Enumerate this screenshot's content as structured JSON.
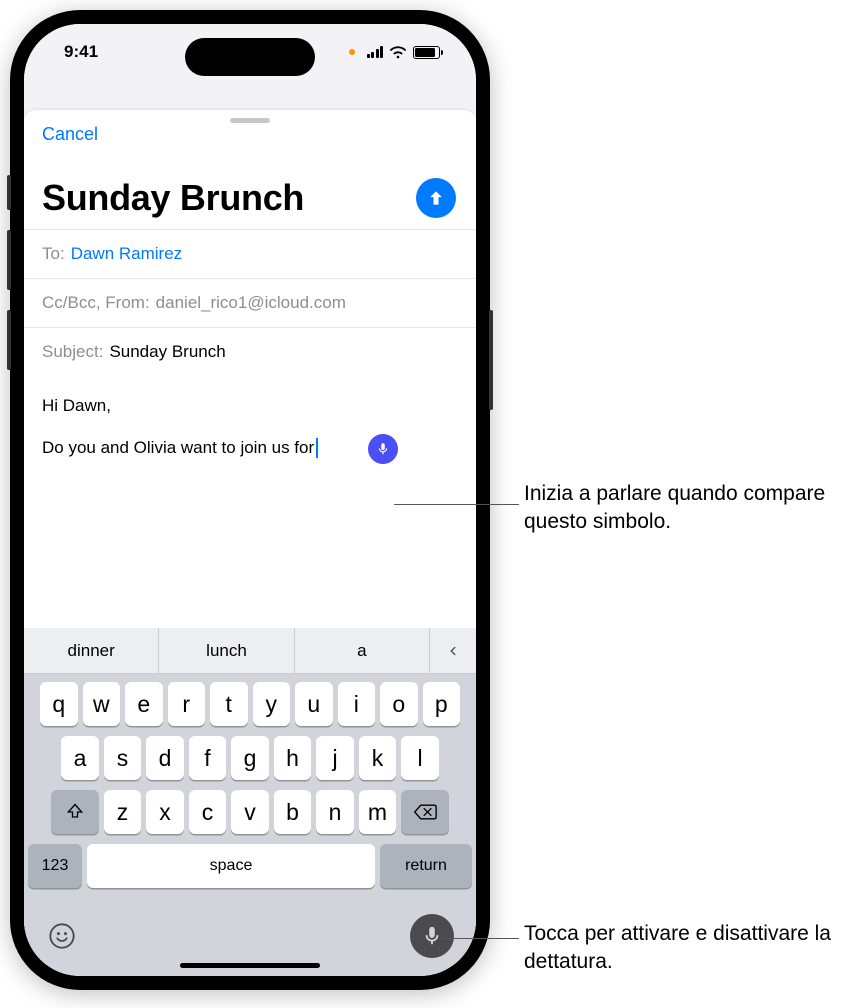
{
  "status": {
    "time": "9:41"
  },
  "compose": {
    "cancel": "Cancel",
    "title": "Sunday Brunch",
    "to_label": "To:",
    "to_value": "Dawn Ramirez",
    "cc_label": "Cc/Bcc, From:",
    "cc_value": "daniel_rico1@icloud.com",
    "subject_label": "Subject:",
    "subject_value": "Sunday Brunch",
    "body_line1": "Hi Dawn,",
    "body_line2": "Do you and Olivia want to join us for"
  },
  "keyboard": {
    "suggestions": [
      "dinner",
      "lunch",
      "a"
    ],
    "row1": [
      "q",
      "w",
      "e",
      "r",
      "t",
      "y",
      "u",
      "i",
      "o",
      "p"
    ],
    "row2": [
      "a",
      "s",
      "d",
      "f",
      "g",
      "h",
      "j",
      "k",
      "l"
    ],
    "row3": [
      "z",
      "x",
      "c",
      "v",
      "b",
      "n",
      "m"
    ],
    "num": "123",
    "space": "space",
    "return": "return"
  },
  "callouts": {
    "dictation": "Inizia a parlare quando compare questo simbolo.",
    "mic": "Tocca per attivare e disattivare la dettatura."
  }
}
